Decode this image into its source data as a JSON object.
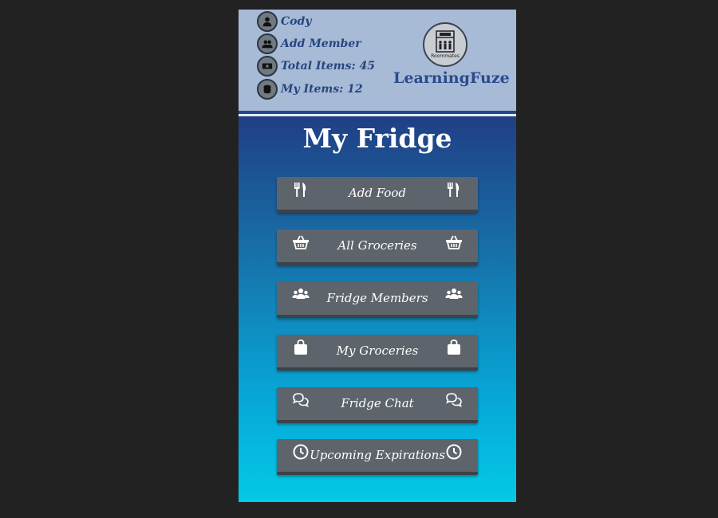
{
  "user": {
    "name": "Cody",
    "add_member_label": "Add Member",
    "total_items_label": "Total Items: 45",
    "my_items_label": "My Items: 12"
  },
  "brand": {
    "logo_caption": "Roommates",
    "name": "LearningFuze"
  },
  "page": {
    "title": "My Fridge"
  },
  "menu": [
    {
      "label": "Add Food",
      "icon": "utensils-icon"
    },
    {
      "label": "All Groceries",
      "icon": "basket-icon"
    },
    {
      "label": "Fridge Members",
      "icon": "users-icon"
    },
    {
      "label": "My Groceries",
      "icon": "shopping-bag-icon"
    },
    {
      "label": "Fridge Chat",
      "icon": "comments-icon"
    },
    {
      "label": "Upcoming Expirations",
      "icon": "clock-icon"
    }
  ],
  "colors": {
    "background": "#222222",
    "header": "#a7bad6",
    "header_text": "#26467f",
    "button": "#5e646b",
    "gradient_top": "#203f85",
    "gradient_bottom": "#04c9e6"
  }
}
